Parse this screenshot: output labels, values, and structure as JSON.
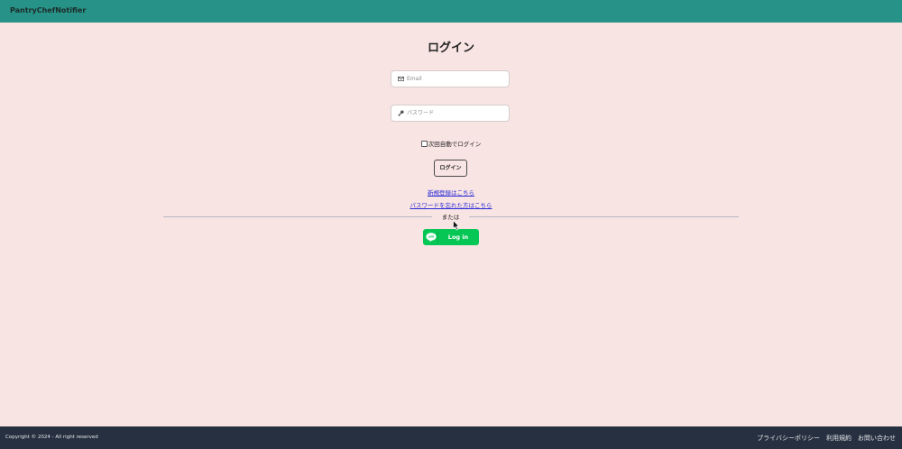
{
  "header": {
    "brand": "PantryChefNotifier"
  },
  "login": {
    "title": "ログイン",
    "email": {
      "placeholder": "Email",
      "value": ""
    },
    "password": {
      "placeholder": "パスワード",
      "value": ""
    },
    "remember_label": "次回自動でログイン",
    "remember_checked": false,
    "submit_label": "ログイン",
    "signup_link": "新規登録はこちら",
    "forgot_link": "パスワードを忘れた方はこちら",
    "divider_text": "または",
    "line_button": {
      "badge": "LINE",
      "label": "Log in"
    }
  },
  "colors": {
    "header_bg": "#279287",
    "page_bg": "#f8e4e2",
    "footer_bg": "#273040",
    "line_green": "#06c755",
    "link": "#2a2ad8"
  },
  "icons": {
    "email": "envelope-icon",
    "password": "key-icon",
    "line": "line-chat-bubble-icon"
  },
  "footer": {
    "copyright": "Copyright © 2024 - All right reserved",
    "links": [
      "プライバシーポリシー",
      "利用規約",
      "お問い合わせ"
    ]
  }
}
